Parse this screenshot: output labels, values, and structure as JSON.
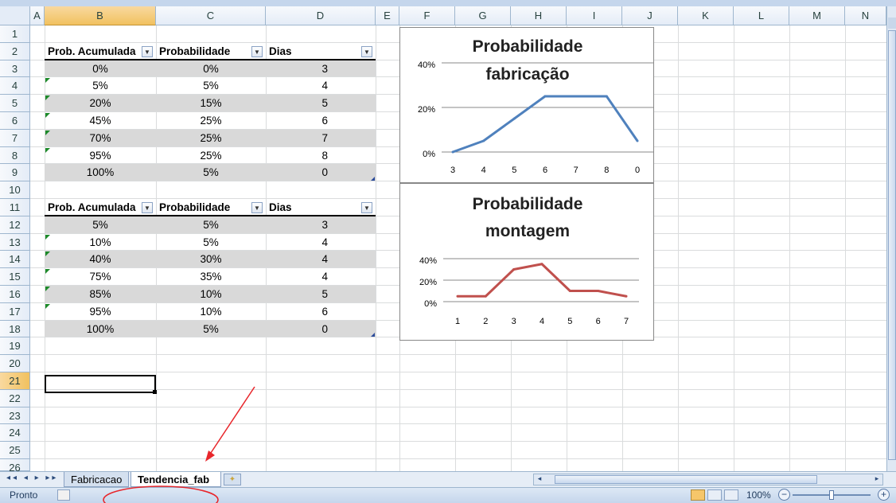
{
  "columns": [
    "A",
    "B",
    "C",
    "D",
    "E",
    "F",
    "G",
    "H",
    "I",
    "J",
    "K",
    "L",
    "M",
    "N"
  ],
  "rows": [
    "1",
    "2",
    "3",
    "4",
    "5",
    "6",
    "7",
    "8",
    "9",
    "10",
    "11",
    "12",
    "13",
    "14",
    "15",
    "16",
    "17",
    "18",
    "19",
    "20",
    "21",
    "22",
    "23",
    "24",
    "25",
    "26"
  ],
  "table1": {
    "headers": [
      "Prob. Acumulada",
      "Probabilidade",
      "Dias"
    ],
    "rows": [
      [
        "0%",
        "0%",
        "3"
      ],
      [
        "5%",
        "5%",
        "4"
      ],
      [
        "20%",
        "15%",
        "5"
      ],
      [
        "45%",
        "25%",
        "6"
      ],
      [
        "70%",
        "25%",
        "7"
      ],
      [
        "95%",
        "25%",
        "8"
      ],
      [
        "100%",
        "5%",
        "0"
      ]
    ]
  },
  "table2": {
    "headers": [
      "Prob. Acumulada",
      "Probabilidade",
      "Dias"
    ],
    "rows": [
      [
        "5%",
        "5%",
        "3"
      ],
      [
        "10%",
        "5%",
        "4"
      ],
      [
        "40%",
        "30%",
        "4"
      ],
      [
        "75%",
        "35%",
        "4"
      ],
      [
        "85%",
        "10%",
        "5"
      ],
      [
        "95%",
        "10%",
        "6"
      ],
      [
        "100%",
        "5%",
        "0"
      ]
    ]
  },
  "chart_data": [
    {
      "type": "line",
      "title": "Probabilidade fabricação",
      "title_lines": [
        "Probabilidade",
        "fabricação"
      ],
      "categories": [
        "3",
        "4",
        "5",
        "6",
        "7",
        "8",
        "0"
      ],
      "values": [
        0,
        5,
        15,
        25,
        25,
        25,
        5
      ],
      "yticks": [
        "0%",
        "20%",
        "40%"
      ],
      "ylim": [
        0,
        40
      ],
      "color": "#4f81bd"
    },
    {
      "type": "line",
      "title": "Probabilidade montagem",
      "title_lines": [
        "Probabilidade",
        "montagem"
      ],
      "categories": [
        "1",
        "2",
        "3",
        "4",
        "5",
        "6",
        "7"
      ],
      "values": [
        5,
        5,
        30,
        35,
        10,
        10,
        5
      ],
      "yticks": [
        "0%",
        "20%",
        "40%"
      ],
      "ylim": [
        0,
        40
      ],
      "color": "#c0504d"
    }
  ],
  "sheet_tabs": [
    "Fabricacao",
    "Tendencia_fab"
  ],
  "active_tab": "Tendencia_fab",
  "status": {
    "mode": "Pronto",
    "zoom": "100%"
  },
  "annotation_color": "#e8262b"
}
